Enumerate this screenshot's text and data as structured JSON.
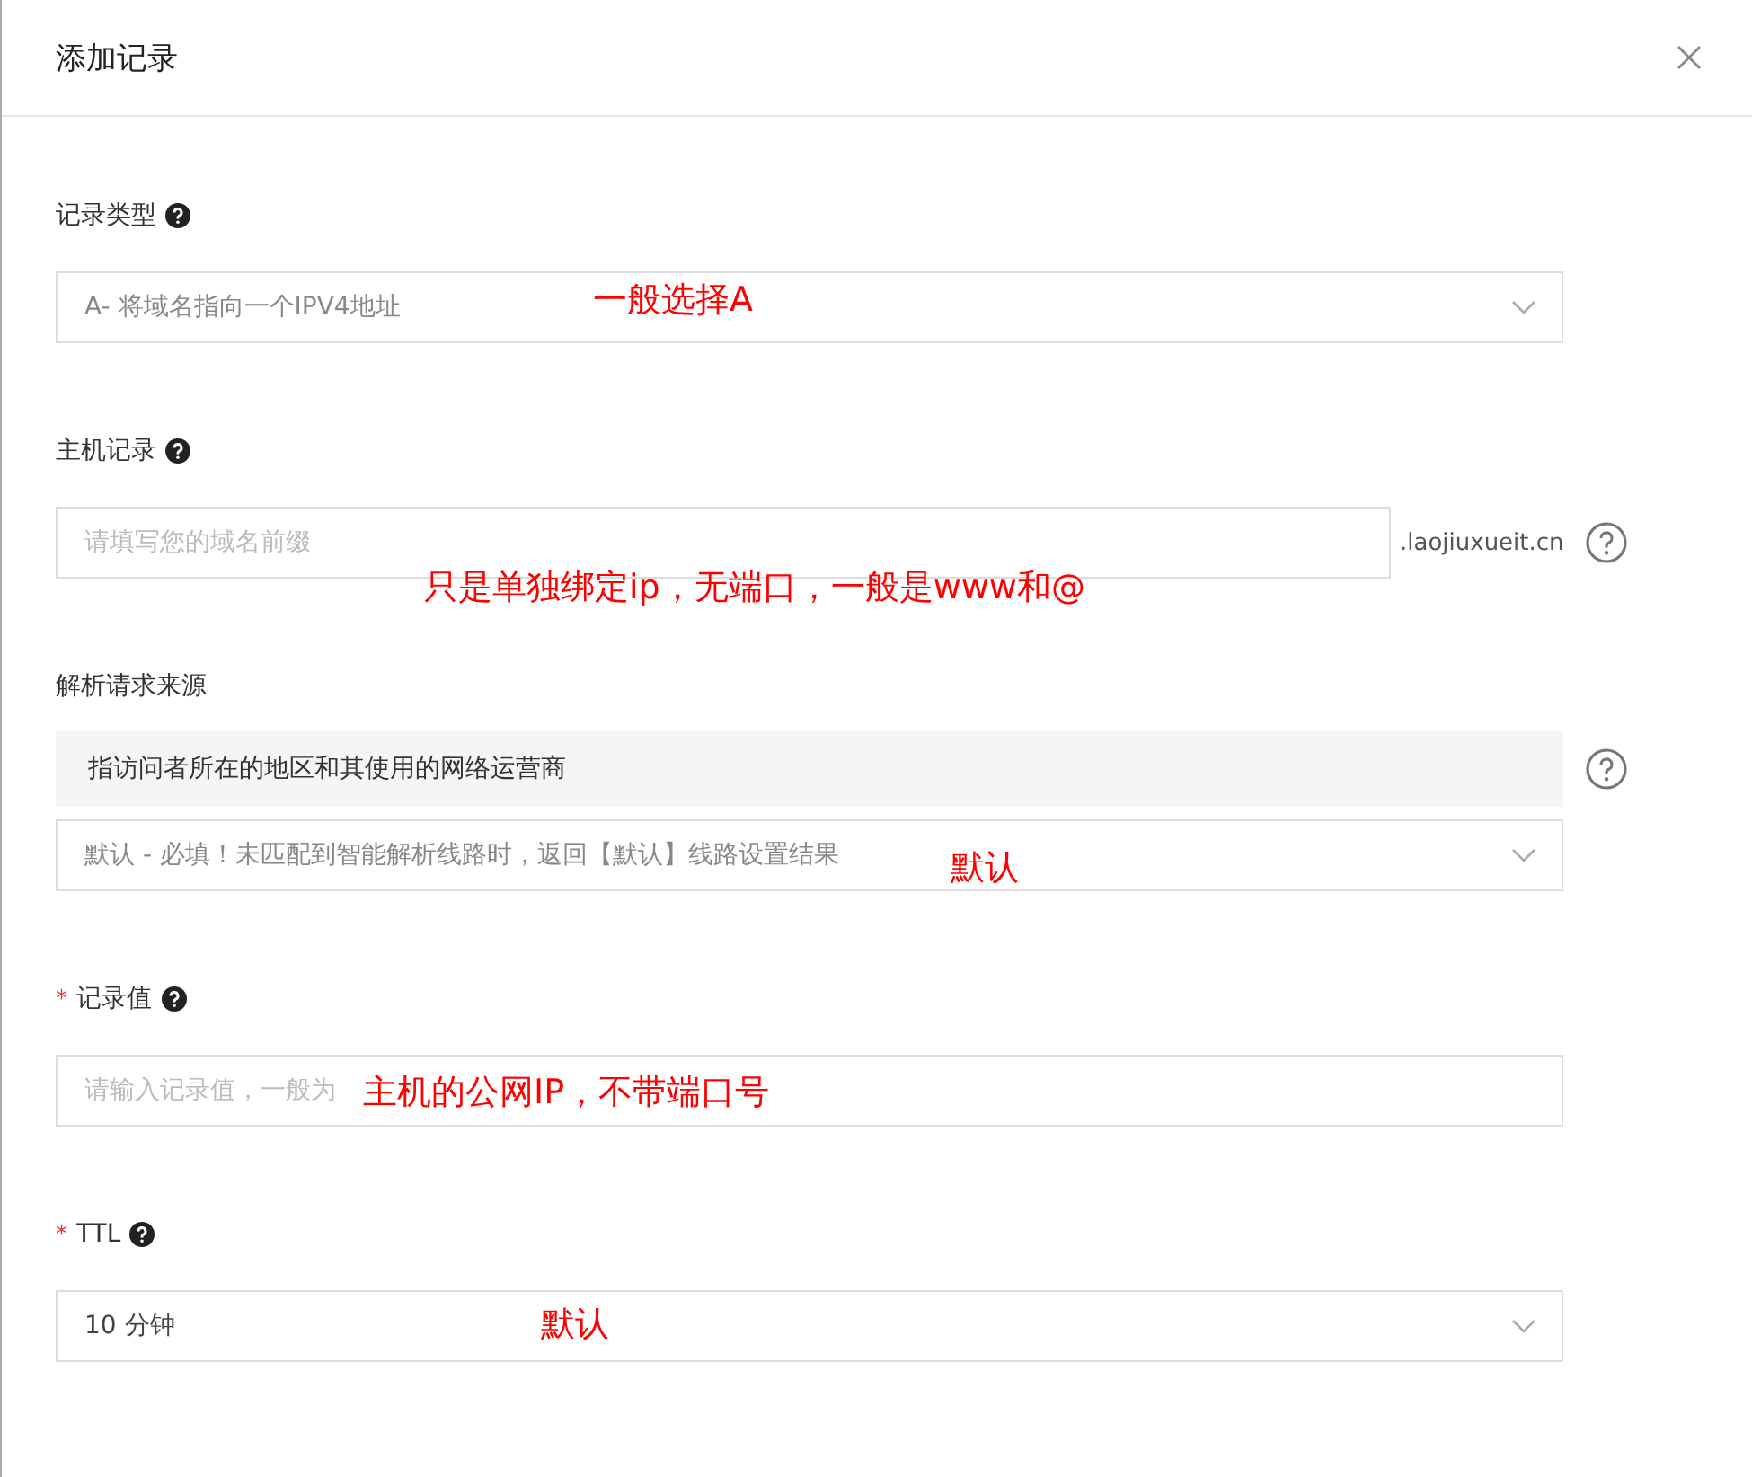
{
  "dialog": {
    "title": "添加记录"
  },
  "fields": [
    {
      "kind": "select",
      "label": "记录类型",
      "help": true,
      "value": "A- 将域名指向一个IPV4地址",
      "muted": true,
      "annotation": "一般选择A"
    },
    {
      "kind": "input",
      "label": "主机记录",
      "help": true,
      "placeholder": "请填写您的域名前缀",
      "suffix": ".laojiuxueit.cn",
      "outer_help": true,
      "annotation": "只是单独绑定ip，无端口，一般是www和@"
    },
    {
      "kind": "select",
      "label": "解析请求来源",
      "info": "指访问者所在的地区和其使用的网络运营商",
      "outer_help": true,
      "value": "默认 - 必填！未匹配到智能解析线路时，返回【默认】线路设置结果",
      "muted": true,
      "annotation": "默认"
    },
    {
      "kind": "input",
      "label": "记录值",
      "required_mark": "*",
      "help": true,
      "placeholder": "请输入记录值，一般为",
      "annotation": "主机的公网IP，不带端口号"
    },
    {
      "kind": "select",
      "label": "TTL",
      "required_mark": "*",
      "help": true,
      "value": "10 分钟",
      "muted": false,
      "annotation": "默认"
    }
  ]
}
